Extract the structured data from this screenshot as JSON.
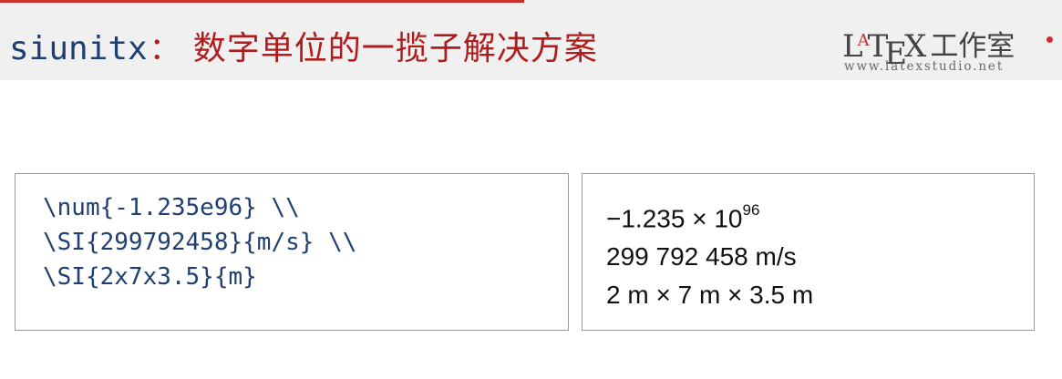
{
  "header": {
    "package": "siunitx",
    "colon": "：",
    "title": "数字单位的一揽子解决方案"
  },
  "brand": {
    "logo_l": "L",
    "logo_a": "A",
    "logo_t": "T",
    "logo_e": "E",
    "logo_x": "X",
    "logo_cn": "工作室",
    "url": "www.latexstudio.net"
  },
  "code": {
    "lines": [
      "\\num{-1.235e96} \\\\",
      "\\SI{299792458}{m/s} \\\\",
      "\\SI{2x7x3.5}{m}"
    ]
  },
  "result": {
    "line1_base": "−1.235 × 10",
    "line1_exp": "96",
    "line2": "299 792 458 m/s",
    "line3": "2 m × 7 m × 3.5 m"
  },
  "colors": {
    "title_red": "#b01c1c",
    "code_blue": "#1f3f73",
    "header_bg": "#f0f0f0"
  }
}
